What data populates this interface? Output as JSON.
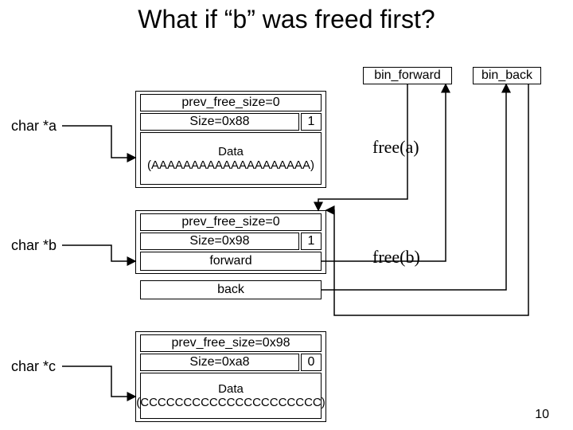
{
  "title": "What if “b” was freed first?",
  "bin_forward": "bin_forward",
  "bin_back": "bin_back",
  "labels": {
    "a": "char *a",
    "b": "char *b",
    "c": "char *c"
  },
  "free": {
    "a": "free(a)",
    "b": "free(b)"
  },
  "blockA": {
    "prev": "prev_free_size=0",
    "size": "Size=0x88",
    "flag": "1",
    "data": "Data\n(AAAAAAAAAAAAAAAAAAAA)"
  },
  "blockB": {
    "prev": "prev_free_size=0",
    "size": "Size=0x98",
    "flag": "1",
    "forward": "forward",
    "back": "back"
  },
  "blockC": {
    "prev": "prev_free_size=0x98",
    "size": "Size=0xa8",
    "flag": "0",
    "data": "Data\n(CCCCCCCCCCCCCCCCCCCCC)"
  },
  "pagenum": "10"
}
